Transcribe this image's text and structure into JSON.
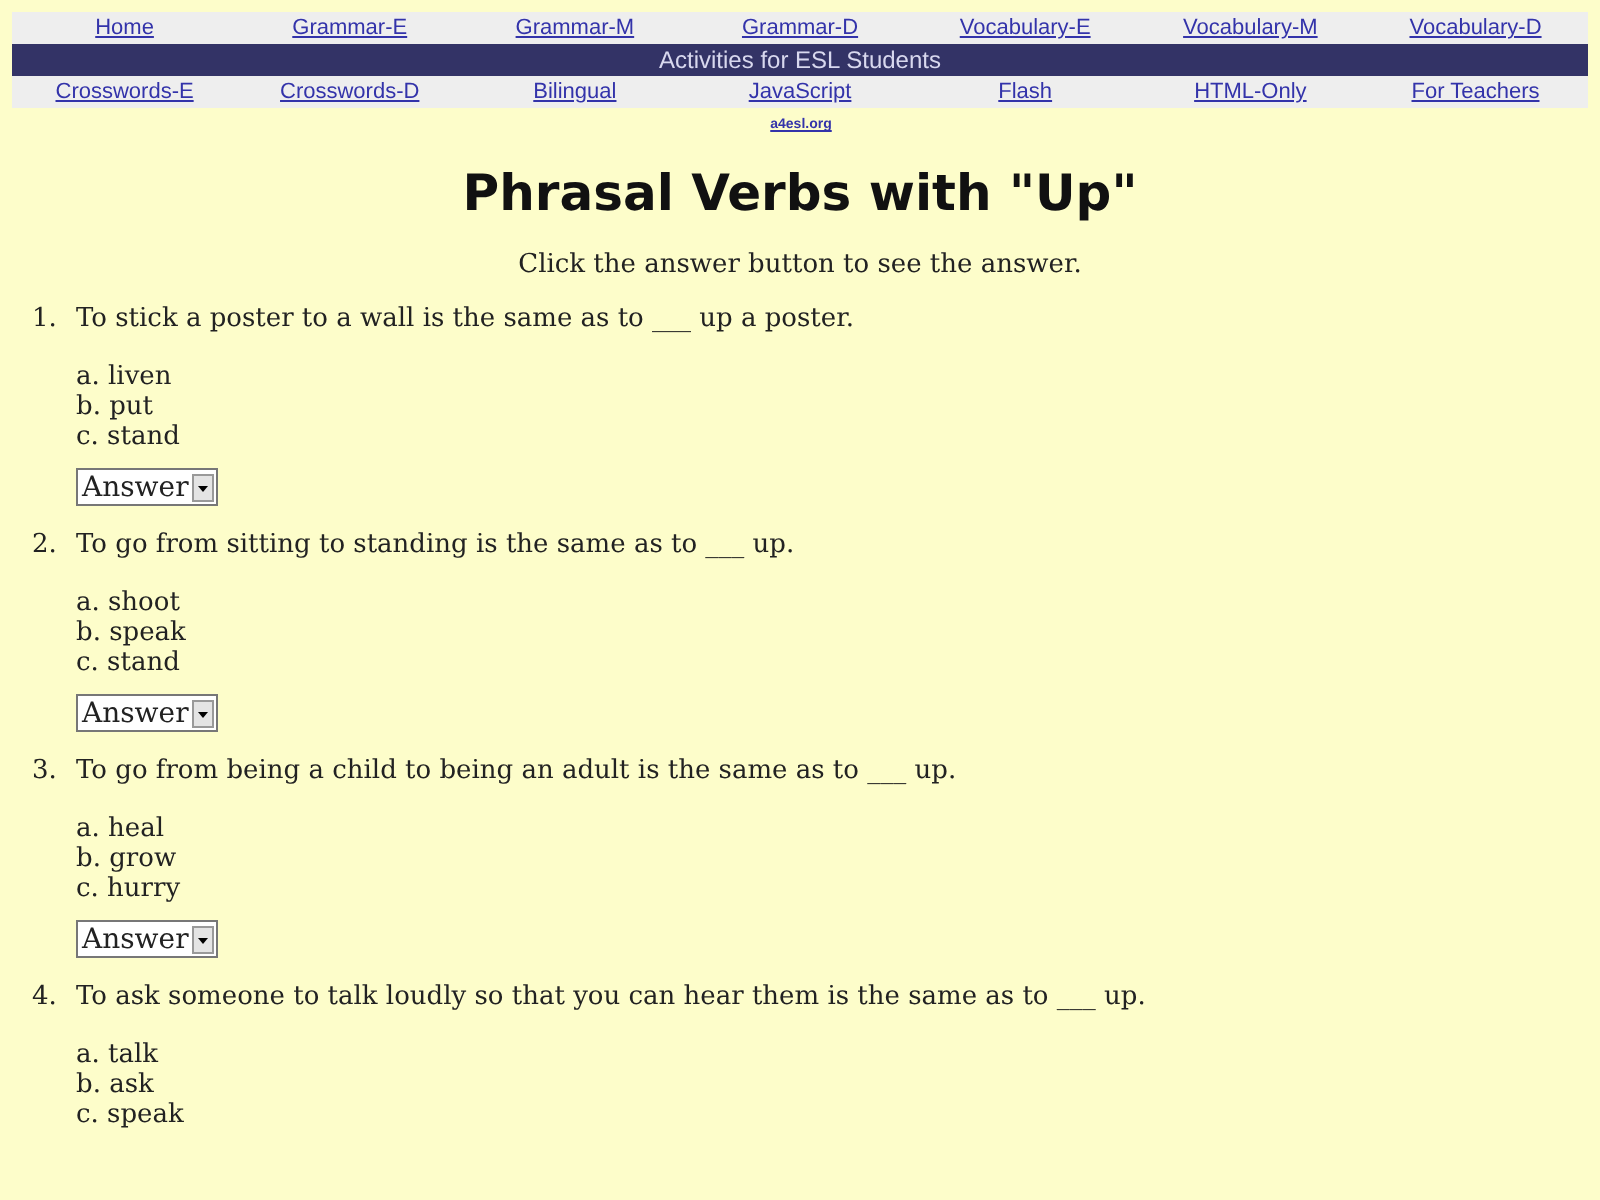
{
  "nav_top": [
    "Home",
    "Grammar-E",
    "Grammar-M",
    "Grammar-D",
    "Vocabulary-E",
    "Vocabulary-M",
    "Vocabulary-D"
  ],
  "banner": "Activities for ESL Students",
  "nav_bottom": [
    "Crosswords-E",
    "Crosswords-D",
    "Bilingual",
    "JavaScript",
    "Flash",
    "HTML-Only",
    "For Teachers"
  ],
  "site_link": "a4esl.org",
  "title": "Phrasal Verbs with \"Up\"",
  "instructions": "Click the answer button to see the answer.",
  "questions": [
    {
      "number": "1.",
      "text": "To stick a poster to a wall is the same as to ___ up a poster.",
      "options": [
        "a. liven",
        "b. put",
        "c. stand"
      ],
      "answer_label": "Answer"
    },
    {
      "number": "2.",
      "text": "To go from sitting to standing is the same as to ___ up.",
      "options": [
        "a. shoot",
        "b. speak",
        "c. stand"
      ],
      "answer_label": "Answer"
    },
    {
      "number": "3.",
      "text": "To go from being a child to being an adult is the same as to ___ up.",
      "options": [
        "a. heal",
        "b. grow",
        "c. hurry"
      ],
      "answer_label": "Answer"
    },
    {
      "number": "4.",
      "text": "To ask someone to talk loudly so that you can hear them is the same as to ___ up.",
      "options": [
        "a. talk",
        "b. ask",
        "c. speak"
      ]
    }
  ]
}
